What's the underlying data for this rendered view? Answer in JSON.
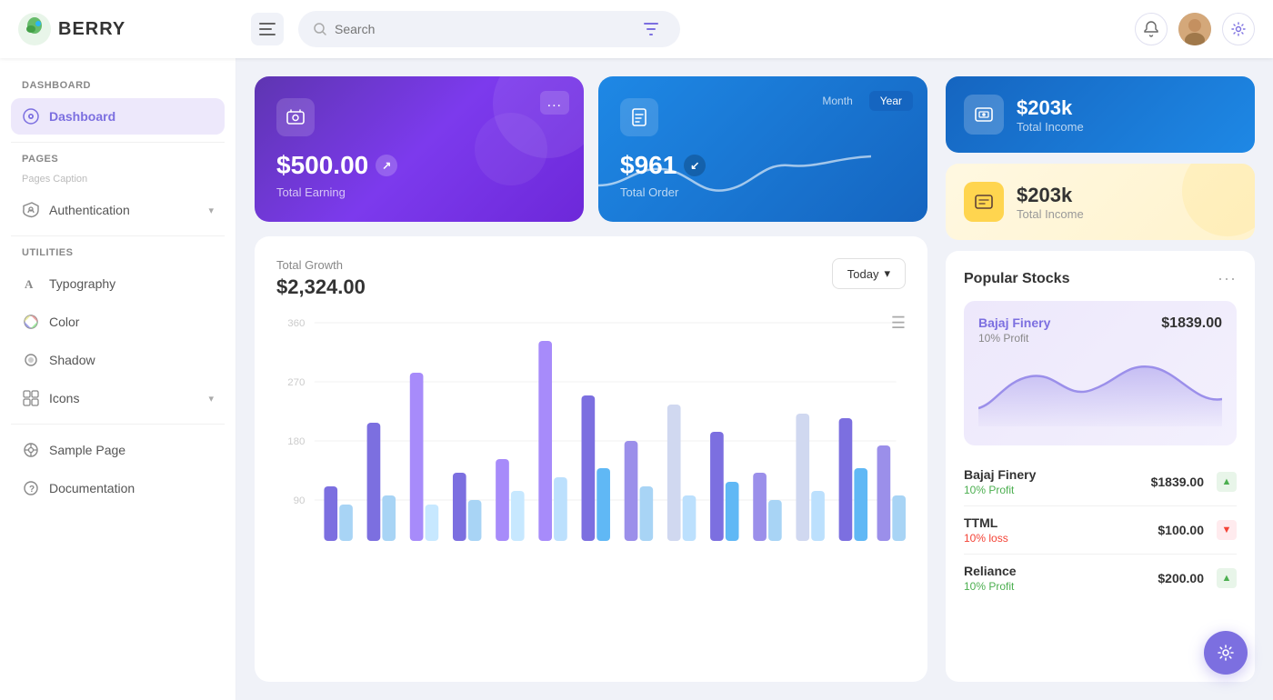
{
  "app": {
    "name": "BERRY",
    "search_placeholder": "Search"
  },
  "sidebar": {
    "dashboard_section": "Dashboard",
    "dashboard_item": "Dashboard",
    "pages_section": "Pages",
    "pages_caption": "Pages Caption",
    "auth_item": "Authentication",
    "utilities_section": "Utilities",
    "typography_item": "Typography",
    "color_item": "Color",
    "shadow_item": "Shadow",
    "icons_item": "Icons",
    "sample_page_item": "Sample Page",
    "documentation_item": "Documentation"
  },
  "cards": {
    "total_earning": {
      "amount": "$500.00",
      "label": "Total Earning",
      "menu": "..."
    },
    "total_order": {
      "amount": "$961",
      "label": "Total Order",
      "period_month": "Month",
      "period_year": "Year"
    },
    "total_income_blue": {
      "value": "$203k",
      "label": "Total Income"
    },
    "total_income_yellow": {
      "value": "$203k",
      "label": "Total Income"
    }
  },
  "growth_chart": {
    "title": "Total Growth",
    "amount": "$2,324.00",
    "period_btn": "Today",
    "y_labels": [
      "360",
      "270",
      "180",
      "90"
    ],
    "menu": "☰"
  },
  "stocks": {
    "title": "Popular Stocks",
    "featured": {
      "name": "Bajaj Finery",
      "price": "$1839.00",
      "change": "10% Profit"
    },
    "list": [
      {
        "name": "Bajaj Finery",
        "price": "$1839.00",
        "change": "10% Profit",
        "direction": "up"
      },
      {
        "name": "TTML",
        "price": "$100.00",
        "change": "10% loss",
        "direction": "down"
      },
      {
        "name": "Reliance",
        "price": "$200.00",
        "change": "10% Profit",
        "direction": "up"
      }
    ]
  }
}
